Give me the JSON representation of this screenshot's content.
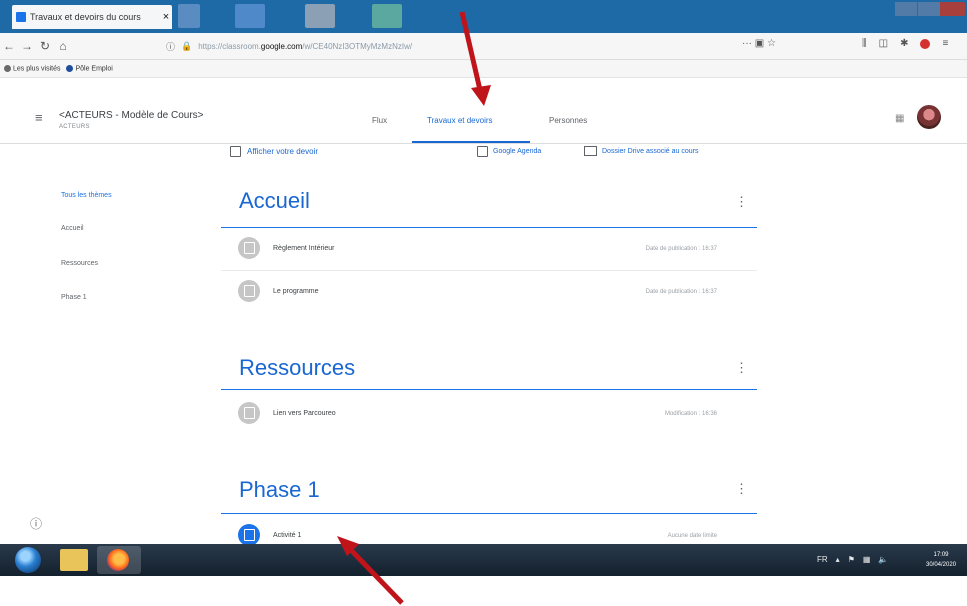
{
  "browser": {
    "tab_title": "Travaux et devoirs du cours",
    "tab_close": "×",
    "url_host": "https://classroom.",
    "url_domain": "google.com",
    "url_path": "/w/CE40NzI3OTMyMzMzNzIw/",
    "bookmarks": [
      {
        "label": "Les plus visités"
      },
      {
        "label": "Pôle Emploi"
      }
    ]
  },
  "classroom": {
    "course_title": "<ACTEURS - Modèle de Cours>",
    "course_subtitle": "ACTEURS",
    "tabs": [
      {
        "label": "Flux"
      },
      {
        "label": "Travaux et devoirs"
      },
      {
        "label": "Personnes"
      }
    ]
  },
  "sidebar": {
    "items": [
      {
        "label": "Tous les thèmes"
      },
      {
        "label": "Accueil"
      },
      {
        "label": "Ressources"
      },
      {
        "label": "Phase 1"
      }
    ]
  },
  "actions": {
    "view_assignments": "Afficher votre devoir",
    "google_calendar": "Google Agenda",
    "drive_folder": "Dossier Drive associé au cours"
  },
  "topics": [
    {
      "title": "Accueil",
      "items": [
        {
          "title": "Règlement Intérieur",
          "date": "Date de publication : 16:37"
        },
        {
          "title": "Le programme",
          "date": "Date de publication : 16:37"
        }
      ]
    },
    {
      "title": "Ressources",
      "items": [
        {
          "title": "Lien vers Parcoureo",
          "date": "Modification : 16:36"
        }
      ]
    },
    {
      "title": "Phase 1",
      "items": [
        {
          "title": "Activité 1",
          "date": "Aucune date limite"
        }
      ]
    }
  ],
  "taskbar": {
    "tray_lang": "FR",
    "clock_time": "17:09",
    "clock_date": "30/04/2020"
  },
  "colors": {
    "accent": "#1967d2",
    "arrow": "#c0141b",
    "taskbar": "#1b2b3a"
  }
}
